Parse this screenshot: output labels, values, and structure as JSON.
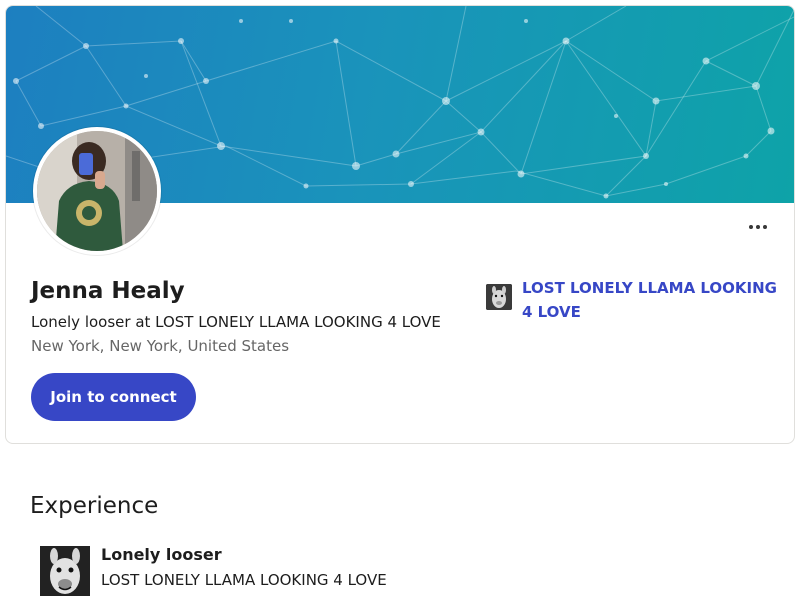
{
  "profile": {
    "name": "Jenna Healy",
    "headline": "Lonely looser at LOST LONELY LLAMA LOOKING 4 LOVE",
    "location": "New York, New York, United States",
    "join_label": "Join to connect",
    "more_icon": "more-horizontal-icon"
  },
  "company": {
    "name": "LOST LONELY LLAMA LOOKING 4 LOVE",
    "logo": "llama-logo"
  },
  "experience": {
    "title": "Experience",
    "items": [
      {
        "role": "Lonely looser",
        "company": "LOST LONELY LLAMA LOOKING 4 LOVE",
        "logo": "llama-logo"
      }
    ]
  },
  "colors": {
    "accent": "#3747c6",
    "cover_start": "#1d7fc0",
    "cover_end": "#0ea3a8"
  }
}
